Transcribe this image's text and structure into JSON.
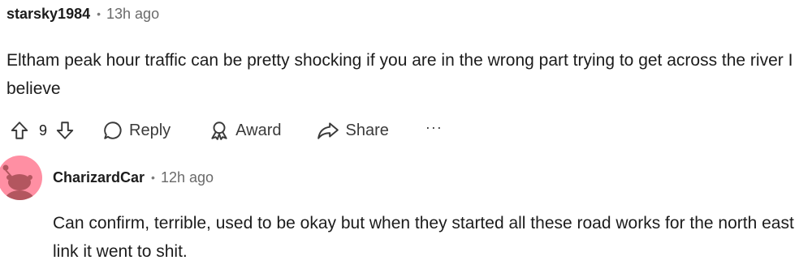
{
  "comment": {
    "author": "starsky1984",
    "time": "13h ago",
    "body": "Eltham peak hour traffic can be pretty shocking if you are in the wrong part trying to get across the river I believe",
    "score": "9",
    "actions": {
      "reply": "Reply",
      "award": "Award",
      "share": "Share",
      "more": "···"
    }
  },
  "reply": {
    "author": "CharizardCar",
    "time": "12h ago",
    "body": "Can confirm, terrible, used to be okay but when they started all these road works for the north east link it went to shit."
  },
  "icons": {
    "upvote": "upvote-icon",
    "downvote": "downvote-icon",
    "reply": "comment-bubble-icon",
    "award": "award-icon",
    "share": "share-arrow-icon",
    "more": "more-options-icon",
    "avatar": "snoo-avatar"
  },
  "colors": {
    "avatar_bg": "#ff8fa3",
    "avatar_figure": "#b3565f",
    "text": "#1c1c1c",
    "meta": "#6a6a6a"
  }
}
